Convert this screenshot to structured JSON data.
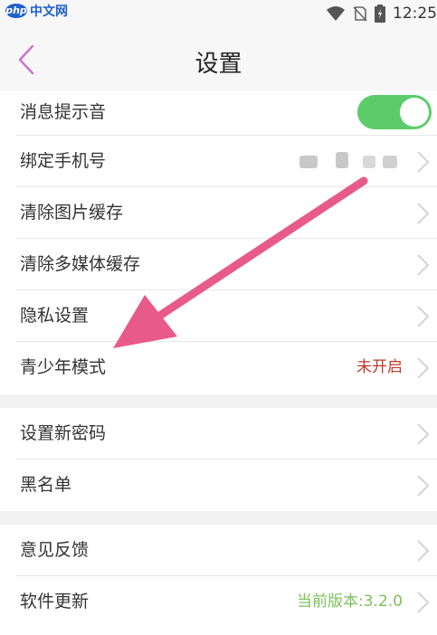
{
  "status_bar": {
    "logo_badge": "php",
    "logo_text": "中文网",
    "time": "12:25",
    "icons": [
      "wifi-icon",
      "no-sim-icon",
      "battery-icon"
    ]
  },
  "header": {
    "title": "设置",
    "back_icon": "chevron-left-icon"
  },
  "settings": {
    "message_sound": {
      "label": "消息提示音",
      "toggle_on": true
    },
    "bind_phone": {
      "label": "绑定手机号"
    },
    "clear_image_cache": {
      "label": "清除图片缓存"
    },
    "clear_media_cache": {
      "label": "清除多媒体缓存"
    },
    "privacy": {
      "label": "隐私设置"
    },
    "youth_mode": {
      "label": "青少年模式",
      "status": "未开启"
    },
    "new_password": {
      "label": "设置新密码"
    },
    "blacklist": {
      "label": "黑名单"
    },
    "feedback": {
      "label": "意见反馈"
    },
    "software_update": {
      "label": "软件更新",
      "version": "当前版本:3.2.0"
    }
  },
  "colors": {
    "accent": "#d070d0",
    "toggle_on": "#5ccc6a",
    "status_off": "#c0392b",
    "version": "#7cc05a",
    "annotation_arrow": "#e85a8a"
  }
}
